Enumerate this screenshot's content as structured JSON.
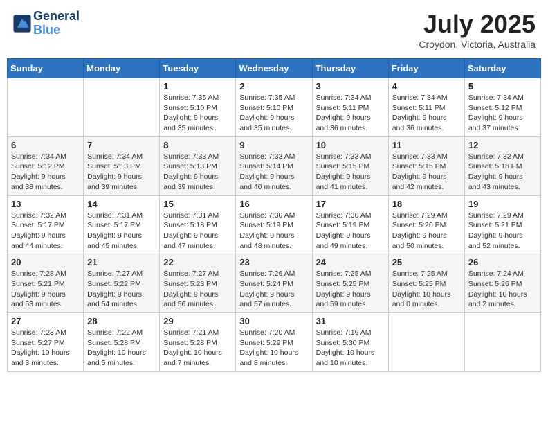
{
  "header": {
    "logo_line1": "General",
    "logo_line2": "Blue",
    "month_year": "July 2025",
    "location": "Croydon, Victoria, Australia"
  },
  "days_of_week": [
    "Sunday",
    "Monday",
    "Tuesday",
    "Wednesday",
    "Thursday",
    "Friday",
    "Saturday"
  ],
  "weeks": [
    [
      {
        "day": "",
        "info": ""
      },
      {
        "day": "",
        "info": ""
      },
      {
        "day": "1",
        "info": "Sunrise: 7:35 AM\nSunset: 5:10 PM\nDaylight: 9 hours\nand 35 minutes."
      },
      {
        "day": "2",
        "info": "Sunrise: 7:35 AM\nSunset: 5:10 PM\nDaylight: 9 hours\nand 35 minutes."
      },
      {
        "day": "3",
        "info": "Sunrise: 7:34 AM\nSunset: 5:11 PM\nDaylight: 9 hours\nand 36 minutes."
      },
      {
        "day": "4",
        "info": "Sunrise: 7:34 AM\nSunset: 5:11 PM\nDaylight: 9 hours\nand 36 minutes."
      },
      {
        "day": "5",
        "info": "Sunrise: 7:34 AM\nSunset: 5:12 PM\nDaylight: 9 hours\nand 37 minutes."
      }
    ],
    [
      {
        "day": "6",
        "info": "Sunrise: 7:34 AM\nSunset: 5:12 PM\nDaylight: 9 hours\nand 38 minutes."
      },
      {
        "day": "7",
        "info": "Sunrise: 7:34 AM\nSunset: 5:13 PM\nDaylight: 9 hours\nand 39 minutes."
      },
      {
        "day": "8",
        "info": "Sunrise: 7:33 AM\nSunset: 5:13 PM\nDaylight: 9 hours\nand 39 minutes."
      },
      {
        "day": "9",
        "info": "Sunrise: 7:33 AM\nSunset: 5:14 PM\nDaylight: 9 hours\nand 40 minutes."
      },
      {
        "day": "10",
        "info": "Sunrise: 7:33 AM\nSunset: 5:15 PM\nDaylight: 9 hours\nand 41 minutes."
      },
      {
        "day": "11",
        "info": "Sunrise: 7:33 AM\nSunset: 5:15 PM\nDaylight: 9 hours\nand 42 minutes."
      },
      {
        "day": "12",
        "info": "Sunrise: 7:32 AM\nSunset: 5:16 PM\nDaylight: 9 hours\nand 43 minutes."
      }
    ],
    [
      {
        "day": "13",
        "info": "Sunrise: 7:32 AM\nSunset: 5:17 PM\nDaylight: 9 hours\nand 44 minutes."
      },
      {
        "day": "14",
        "info": "Sunrise: 7:31 AM\nSunset: 5:17 PM\nDaylight: 9 hours\nand 45 minutes."
      },
      {
        "day": "15",
        "info": "Sunrise: 7:31 AM\nSunset: 5:18 PM\nDaylight: 9 hours\nand 47 minutes."
      },
      {
        "day": "16",
        "info": "Sunrise: 7:30 AM\nSunset: 5:19 PM\nDaylight: 9 hours\nand 48 minutes."
      },
      {
        "day": "17",
        "info": "Sunrise: 7:30 AM\nSunset: 5:19 PM\nDaylight: 9 hours\nand 49 minutes."
      },
      {
        "day": "18",
        "info": "Sunrise: 7:29 AM\nSunset: 5:20 PM\nDaylight: 9 hours\nand 50 minutes."
      },
      {
        "day": "19",
        "info": "Sunrise: 7:29 AM\nSunset: 5:21 PM\nDaylight: 9 hours\nand 52 minutes."
      }
    ],
    [
      {
        "day": "20",
        "info": "Sunrise: 7:28 AM\nSunset: 5:21 PM\nDaylight: 9 hours\nand 53 minutes."
      },
      {
        "day": "21",
        "info": "Sunrise: 7:27 AM\nSunset: 5:22 PM\nDaylight: 9 hours\nand 54 minutes."
      },
      {
        "day": "22",
        "info": "Sunrise: 7:27 AM\nSunset: 5:23 PM\nDaylight: 9 hours\nand 56 minutes."
      },
      {
        "day": "23",
        "info": "Sunrise: 7:26 AM\nSunset: 5:24 PM\nDaylight: 9 hours\nand 57 minutes."
      },
      {
        "day": "24",
        "info": "Sunrise: 7:25 AM\nSunset: 5:25 PM\nDaylight: 9 hours\nand 59 minutes."
      },
      {
        "day": "25",
        "info": "Sunrise: 7:25 AM\nSunset: 5:25 PM\nDaylight: 10 hours\nand 0 minutes."
      },
      {
        "day": "26",
        "info": "Sunrise: 7:24 AM\nSunset: 5:26 PM\nDaylight: 10 hours\nand 2 minutes."
      }
    ],
    [
      {
        "day": "27",
        "info": "Sunrise: 7:23 AM\nSunset: 5:27 PM\nDaylight: 10 hours\nand 3 minutes."
      },
      {
        "day": "28",
        "info": "Sunrise: 7:22 AM\nSunset: 5:28 PM\nDaylight: 10 hours\nand 5 minutes."
      },
      {
        "day": "29",
        "info": "Sunrise: 7:21 AM\nSunset: 5:28 PM\nDaylight: 10 hours\nand 7 minutes."
      },
      {
        "day": "30",
        "info": "Sunrise: 7:20 AM\nSunset: 5:29 PM\nDaylight: 10 hours\nand 8 minutes."
      },
      {
        "day": "31",
        "info": "Sunrise: 7:19 AM\nSunset: 5:30 PM\nDaylight: 10 hours\nand 10 minutes."
      },
      {
        "day": "",
        "info": ""
      },
      {
        "day": "",
        "info": ""
      }
    ]
  ]
}
